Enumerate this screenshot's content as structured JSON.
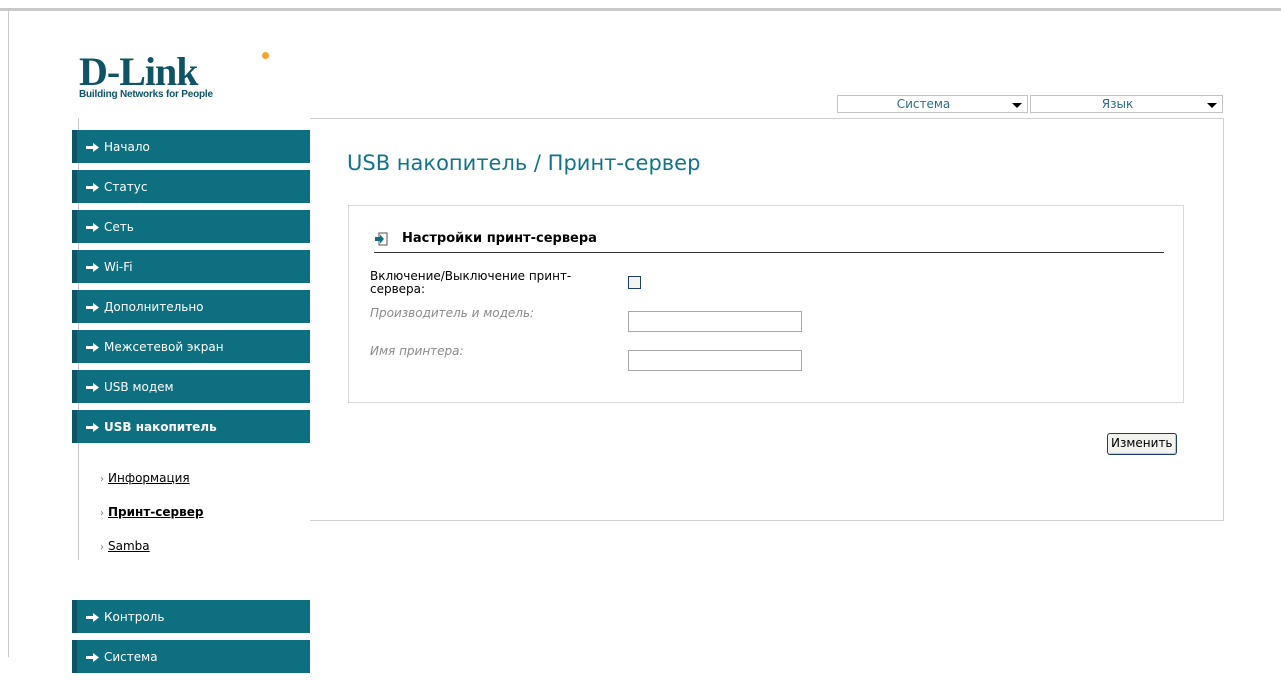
{
  "brand": {
    "logo_text": "D-Link",
    "tagline": "Building Networks for People"
  },
  "header": {
    "system_dropdown": "Система",
    "language_dropdown": "Язык"
  },
  "sidebar": {
    "items": [
      {
        "label": "Начало"
      },
      {
        "label": "Статус"
      },
      {
        "label": "Сеть"
      },
      {
        "label": "Wi-Fi"
      },
      {
        "label": "Дополнительно"
      },
      {
        "label": "Межсетевой экран"
      },
      {
        "label": "USB модем"
      },
      {
        "label": "USB накопитель"
      },
      {
        "label": "Контроль"
      },
      {
        "label": "Система"
      }
    ],
    "submenu": [
      {
        "label": "Информация"
      },
      {
        "label": "Принт-сервер"
      },
      {
        "label": "Samba"
      }
    ]
  },
  "main": {
    "title": "USB накопитель / Принт-сервер",
    "section_title": "Настройки принт-сервера",
    "enable_label": "Включение/Выключение принт-сервера:",
    "enable_checked": false,
    "vendor_label": "Производитель и модель:",
    "vendor_value": "",
    "printer_label": "Имя принтера:",
    "printer_value": "",
    "change_button": "Изменить"
  },
  "colors": {
    "nav_bg": "#0e6f81",
    "title": "#12748a",
    "logo": "#0f5366"
  }
}
